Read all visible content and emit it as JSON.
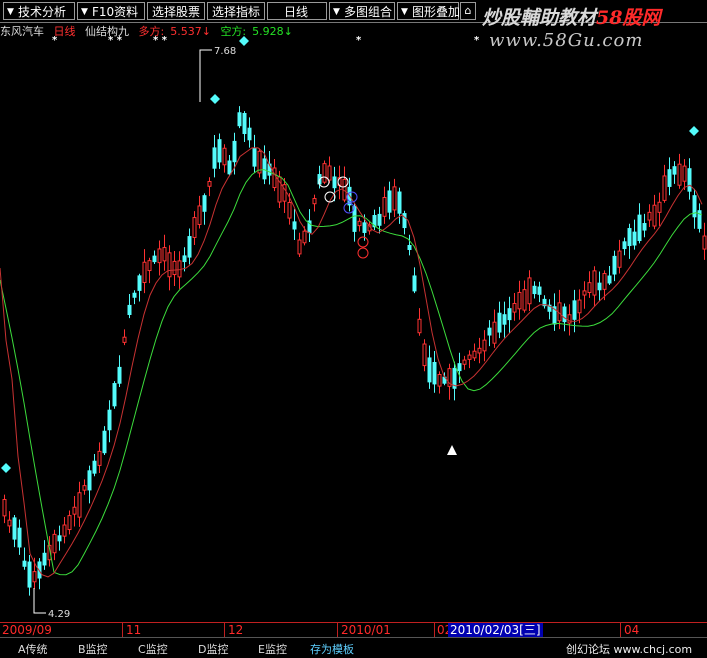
{
  "toolbar": {
    "buttons": [
      "技术分析",
      "F10资料",
      "选择股票",
      "选择指标",
      "日线",
      "多图组合",
      "图形叠加"
    ],
    "overlay_icon": "overlay-icon"
  },
  "watermark": {
    "text_main": "炒股輔助教材",
    "text_brand": "58股网",
    "url": "www.58Gu.com"
  },
  "info": {
    "stock_name": "东风汽车",
    "period": "日线",
    "indicator": "仙结构九",
    "long_label": "多方:",
    "long_value": "5.537↓",
    "short_label": "空方:",
    "short_value": "5.928↓"
  },
  "chart": {
    "high_label": "7.68",
    "low_label": "4.29"
  },
  "timeaxis": {
    "labels": [
      "2009/09",
      "11",
      "12",
      "2010/01",
      "02",
      "04"
    ],
    "cursor_date": "2010/02/03[三]"
  },
  "bottombar": {
    "tabs": [
      "A传统",
      "B监控",
      "C监控",
      "D监控",
      "E监控",
      "存为模板"
    ],
    "forum": "创幻论坛  www.chcj.com"
  },
  "colors": {
    "up": "#ff3232",
    "down": "#54fcfc",
    "ma_short": "#c83232",
    "ma_long": "#3cdc3c"
  }
}
